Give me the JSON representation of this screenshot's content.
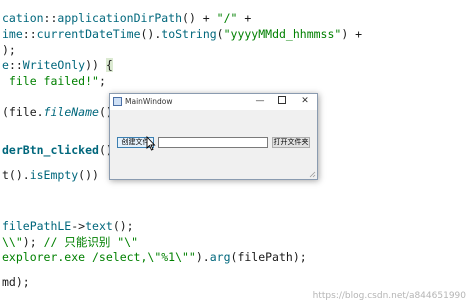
{
  "editor": {
    "line1": {
      "t1": "cation",
      "t2": "::",
      "t3": "applicationDirPath",
      "t4": "() + ",
      "t5": "\"/\"",
      "t6": " +"
    },
    "line2": {
      "t1": "ime",
      "t2": "::",
      "t3": "currentDateTime",
      "t4": "().",
      "t5": "toString",
      "t6": "(",
      "t7": "\"yyyyMMdd_hhmmss\"",
      "t8": ") +"
    },
    "line3": {
      "t1": ");"
    },
    "line4": {
      "t1": "e",
      "t2": "::",
      "t3": "WriteOnly",
      "t4": ")) ",
      "t5": "{"
    },
    "line5": {
      "t1": " file failed!\"",
      "t2": ";"
    },
    "line6": {
      "t1": "(file.",
      "t2": "fileName",
      "t3": "());"
    },
    "line7": {
      "t1": "derBtn_clicked",
      "t2": "()"
    },
    "line8": {
      "t1": "t().",
      "t2": "isEmpty",
      "t3": "())"
    },
    "line9": {
      "t1": "filePathLE",
      "t2": "->",
      "t3": "text",
      "t4": "();"
    },
    "line10": {
      "t1": "\\\\\"",
      "t2": "); ",
      "t3": "// 只能识别 \"\\\""
    },
    "line11": {
      "t1": "explorer.exe /select,\\\"%1\\\"\"",
      "t2": ").",
      "t3": "arg",
      "t4": "(filePath);"
    },
    "line12": {
      "t1": "md);"
    }
  },
  "window": {
    "title": "MainWindow",
    "minimize_glyph": "—",
    "close_glyph": "✕",
    "create_button_label": "创建文件",
    "path_input_value": "",
    "open_folder_button_label": "打开文件夹"
  },
  "watermark": "https://blog.csdn.net/a844651990",
  "colors": {
    "identifier": "#00677c",
    "string": "#008000",
    "keyword": "#808000",
    "window_border": "#8a9bb0",
    "focused_button": "#e5f1fb"
  },
  "icons": [
    "app-icon",
    "minimize-icon",
    "maximize-icon",
    "close-icon",
    "mouse-cursor-icon",
    "resize-grip-icon"
  ]
}
